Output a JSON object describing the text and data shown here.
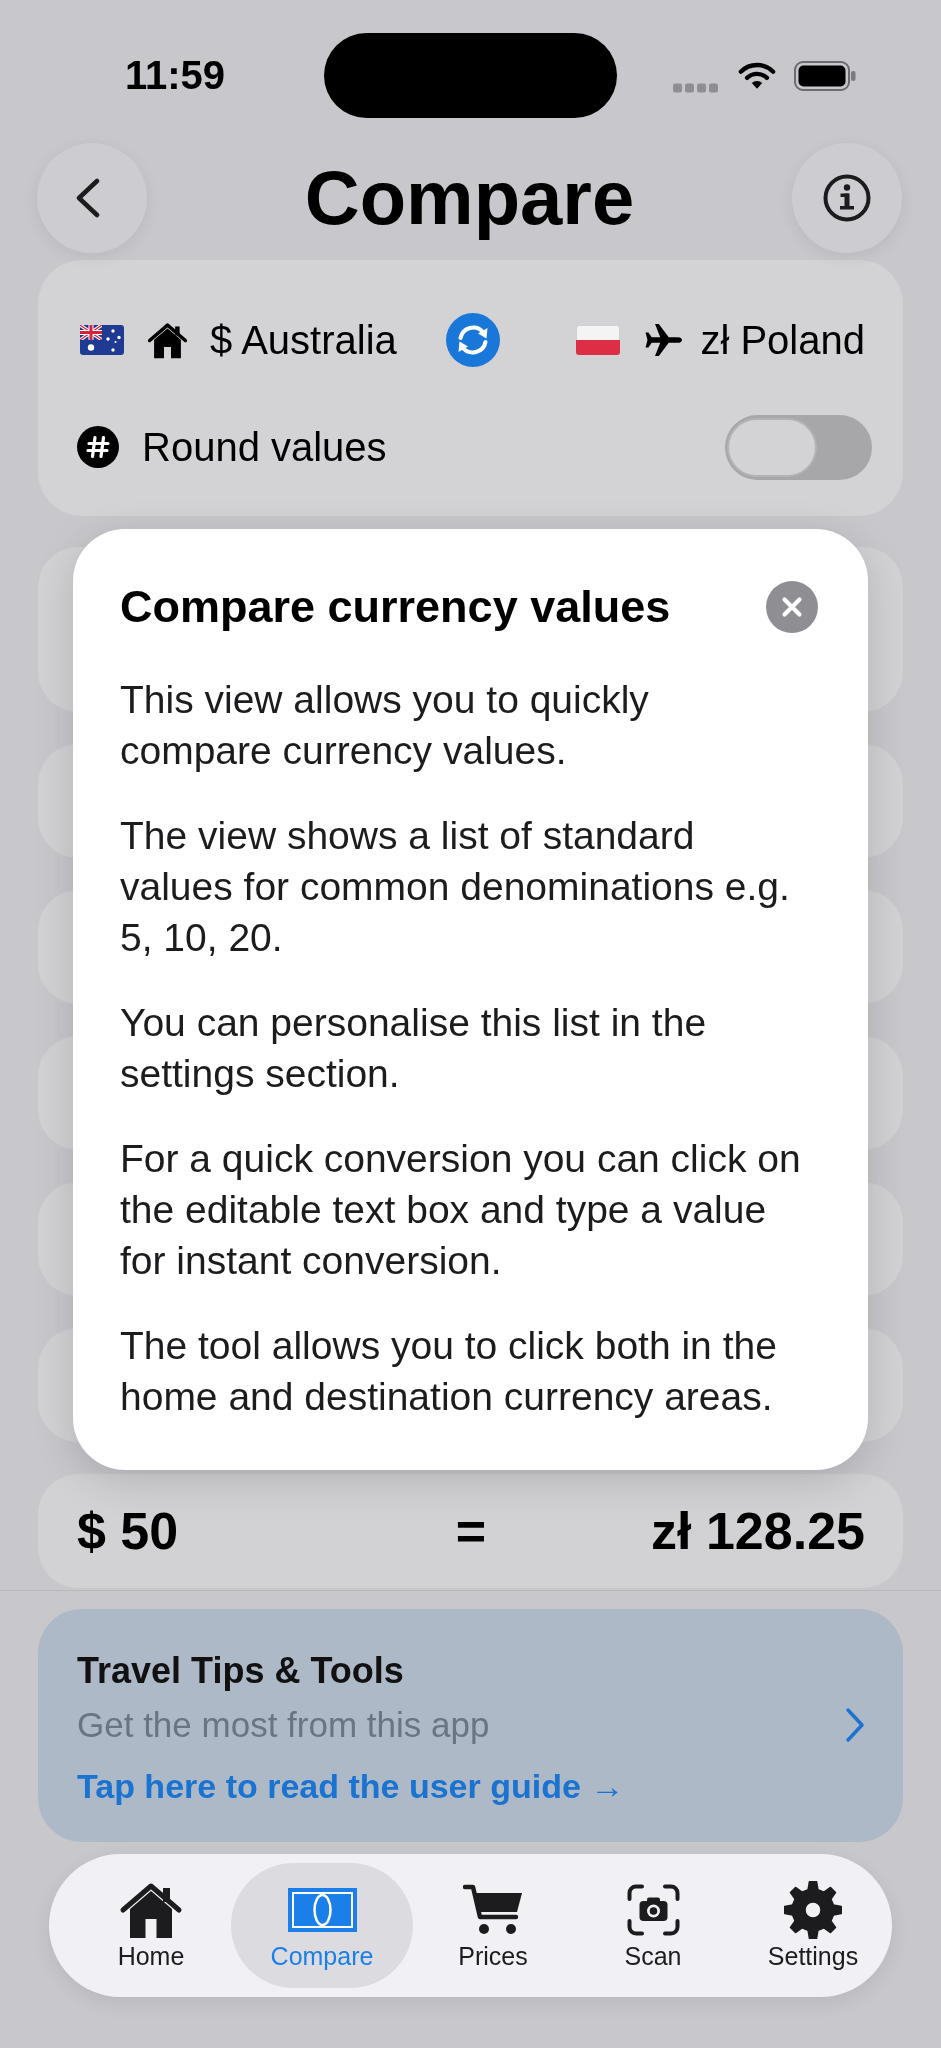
{
  "status_bar": {
    "time": "11:59"
  },
  "header": {
    "title": "Compare"
  },
  "currency_bar": {
    "home_label": "$ Australia",
    "destination_label": "zł Poland"
  },
  "round_values": {
    "label": "Round values",
    "on": false
  },
  "modal": {
    "title": "Compare currency values",
    "paragraphs": [
      "This view allows you to quickly compare currency values.",
      "The view shows a list of standard values for common denominations e.g. 5, 10, 20.",
      "You can personalise this list in the settings section.",
      "For a quick conversion you can click on the editable text box and type a value for instant conversion.",
      "The tool allows you to click both in the home and destination currency areas."
    ]
  },
  "result": {
    "home_value": "$ 50",
    "equals": "=",
    "destination_value": "zł 128.25"
  },
  "tips_card": {
    "title": "Travel Tips & Tools",
    "subtitle": "Get the most from this app",
    "link": "Tap here to read the user guide →"
  },
  "tab_bar": {
    "items": [
      {
        "label": "Home",
        "selected": false
      },
      {
        "label": "Compare",
        "selected": true
      },
      {
        "label": "Prices",
        "selected": false
      },
      {
        "label": "Scan",
        "selected": false
      },
      {
        "label": "Settings",
        "selected": false
      }
    ]
  }
}
